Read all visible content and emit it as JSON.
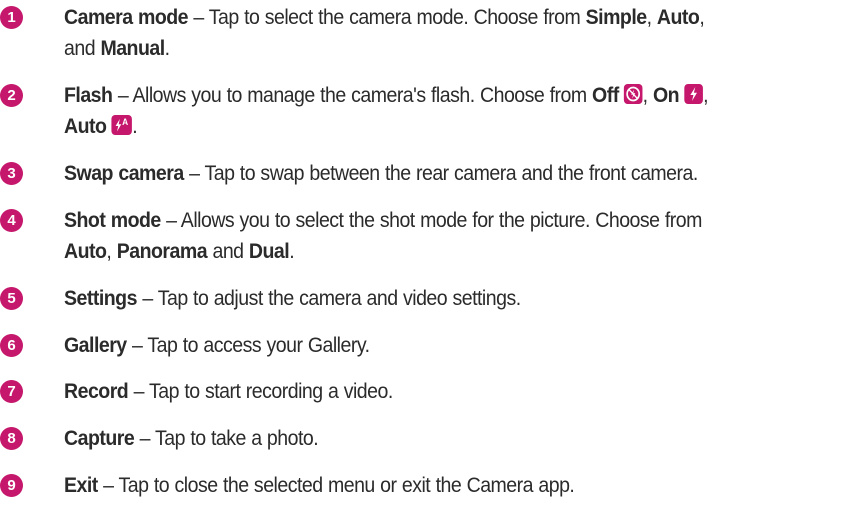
{
  "items": [
    {
      "number": "1",
      "title": "Camera mode",
      "sep": " – ",
      "desc": "Tap to select the camera mode. Choose from ",
      "opt1": "Simple",
      "c1": ", ",
      "opt2": "Auto",
      "c2": ",",
      "line2_pre": "and ",
      "opt3": "Manual",
      "end": "."
    },
    {
      "number": "2",
      "title": "Flash",
      "sep": " – ",
      "desc": "Allows you to manage the camera's flash. Choose from ",
      "opt1": "Off",
      "opt1_icon": "flash-off-icon",
      "c1": ", ",
      "opt2": "On",
      "opt2_icon": "flash-on-icon",
      "c2": ",",
      "opt3": "Auto",
      "opt3_icon": "flash-auto-icon",
      "icon_auto_letter": "A",
      "end": "."
    },
    {
      "number": "3",
      "title": "Swap camera",
      "sep": " – ",
      "desc": "Tap to swap between the rear camera and the front camera."
    },
    {
      "number": "4",
      "title": "Shot mode",
      "sep": " – ",
      "desc": "Allows you to select the shot mode for the picture. Choose from",
      "opt1": "Auto",
      "c1": ", ",
      "opt2": "Panorama",
      "c2": " and ",
      "opt3": "Dual",
      "end": "."
    },
    {
      "number": "5",
      "title": "Settings",
      "sep": " – ",
      "desc": "Tap to adjust the camera and video settings."
    },
    {
      "number": "6",
      "title": "Gallery",
      "sep": " – ",
      "desc": "Tap to access your Gallery."
    },
    {
      "number": "7",
      "title": "Record",
      "sep": " – ",
      "desc": "Tap to start recording a video."
    },
    {
      "number": "8",
      "title": "Capture",
      "sep": " – ",
      "desc": "Tap to take a photo."
    },
    {
      "number": "9",
      "title": "Exit",
      "sep": " – ",
      "desc": "Tap to close the selected menu or exit the Camera app."
    }
  ],
  "colors": {
    "accent": "#c5176b",
    "text": "#2b2b2b"
  }
}
